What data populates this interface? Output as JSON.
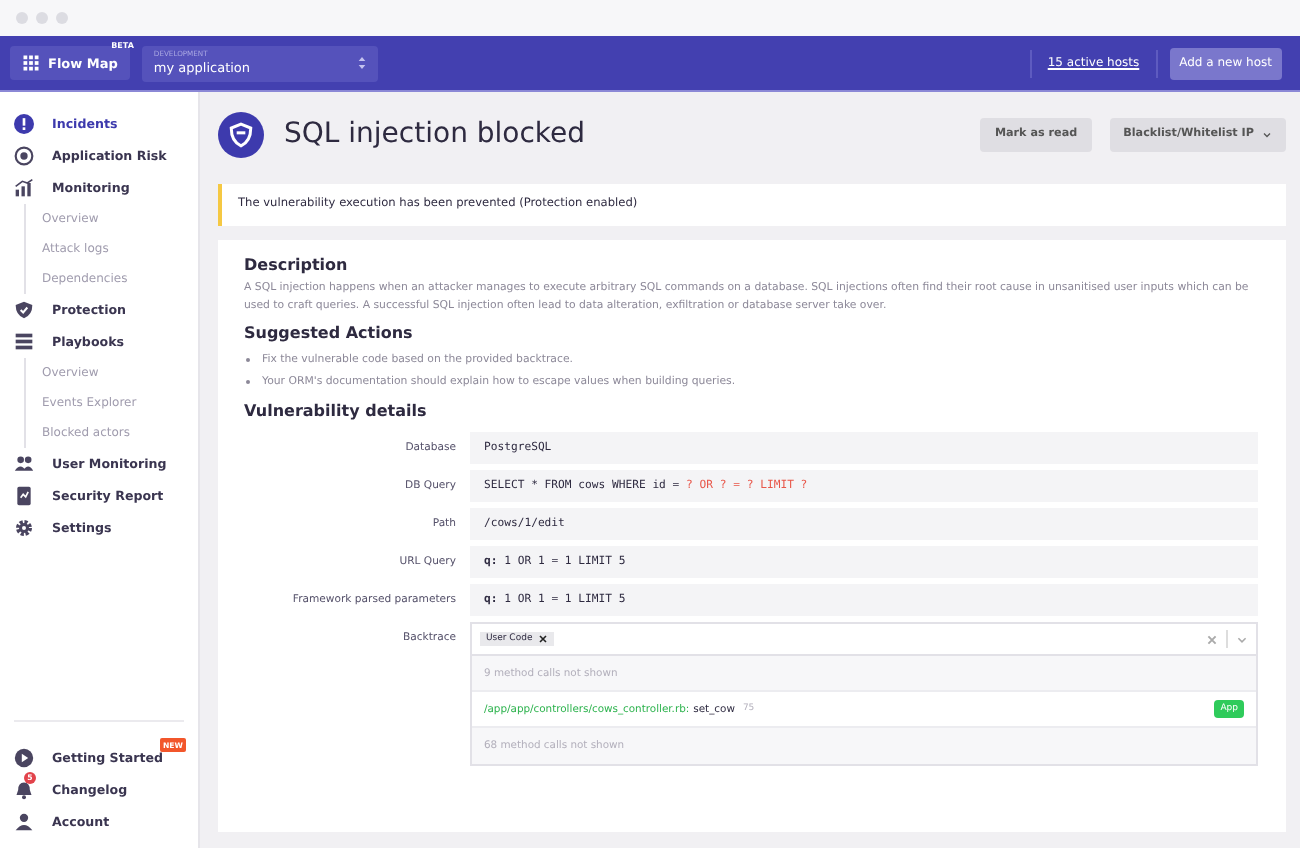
{
  "header": {
    "app_button": {
      "label": "Flow Map",
      "badge": "BETA"
    },
    "environment": {
      "caption": "DEVELOPMENT",
      "value": "my application"
    },
    "hosts_link": "15 active hosts",
    "add_button": "Add a new host"
  },
  "sidebar": {
    "items": [
      {
        "label": "Incidents",
        "selected": true
      },
      {
        "label": "Application Risk",
        "selected": false
      },
      {
        "label": "Monitoring",
        "selected": false,
        "children": [
          {
            "label": "Overview",
            "selected": false
          },
          {
            "label": "Attack logs",
            "selected": false
          },
          {
            "label": "Dependencies",
            "selected": false
          }
        ]
      },
      {
        "label": "Protection",
        "selected": false
      },
      {
        "label": "Playbooks",
        "selected": false,
        "children": [
          {
            "label": "Overview",
            "selected": false
          },
          {
            "label": "Events Explorer",
            "selected": false
          },
          {
            "label": "Blocked actors",
            "selected": false
          }
        ]
      },
      {
        "label": "User Monitoring",
        "selected": false
      },
      {
        "label": "Security Report",
        "selected": false
      },
      {
        "label": "Settings",
        "selected": false
      }
    ],
    "bottom_items": [
      {
        "label": "Getting Started",
        "badge": "NEW"
      },
      {
        "label": "Changelog",
        "count": "5"
      },
      {
        "label": "Account"
      }
    ]
  },
  "page": {
    "title": "SQL injection blocked",
    "actions": [
      {
        "label": "Mark as read",
        "kind": "button"
      },
      {
        "label": "Blacklist/Whitelist IP",
        "kind": "dropdown"
      }
    ],
    "alert": "The vulnerability execution has been prevented (Protection enabled)",
    "description": {
      "heading": "Description",
      "text": "A SQL injection happens when an attacker manages to execute arbitrary SQL commands on a database. SQL injections often find their root cause in unsanitised user inputs which can be used to craft queries. A successful SQL injection often lead to data alteration, exfiltration or database server take over."
    },
    "suggested_actions": {
      "heading": "Suggested Actions",
      "items": [
        "Fix the vulnerable code based on the provided backtrace.",
        "Your ORM's documentation should explain how to escape values when building queries."
      ]
    },
    "details": {
      "heading": "Vulnerability details",
      "rows": [
        {
          "label": "Database",
          "segments": [
            {
              "text": "PostgreSQL",
              "kind": "plain"
            }
          ]
        },
        {
          "label": "DB Query",
          "segments": [
            {
              "text": "SELECT * FROM cows WHERE id = ",
              "kind": "plain"
            },
            {
              "text": "? OR ? = ? LIMIT ?",
              "kind": "injected"
            }
          ]
        },
        {
          "label": "Path",
          "segments": [
            {
              "text": "/cows/1/edit",
              "kind": "plain"
            }
          ]
        },
        {
          "label": "URL Query",
          "segments": [
            {
              "text": "**q:** 1 OR 1 = 1 LIMIT 5",
              "kind": "plain"
            }
          ]
        },
        {
          "label": "Framework parsed parameters",
          "segments": [
            {
              "text": "**q:** 1 OR 1 = 1 LIMIT 5",
              "kind": "plain"
            }
          ]
        }
      ],
      "backtrace": {
        "label": "Backtrace",
        "filter_tag": "User Code",
        "frames": [
          {
            "kind": "hidden",
            "text": "9 method calls not shown"
          },
          {
            "kind": "frame",
            "file": "/app/app/controllers/cows_controller.rb:",
            "method": "set_cow",
            "line": "75",
            "tag": "App"
          },
          {
            "kind": "hidden",
            "text": "68 method calls not shown"
          }
        ]
      }
    }
  }
}
